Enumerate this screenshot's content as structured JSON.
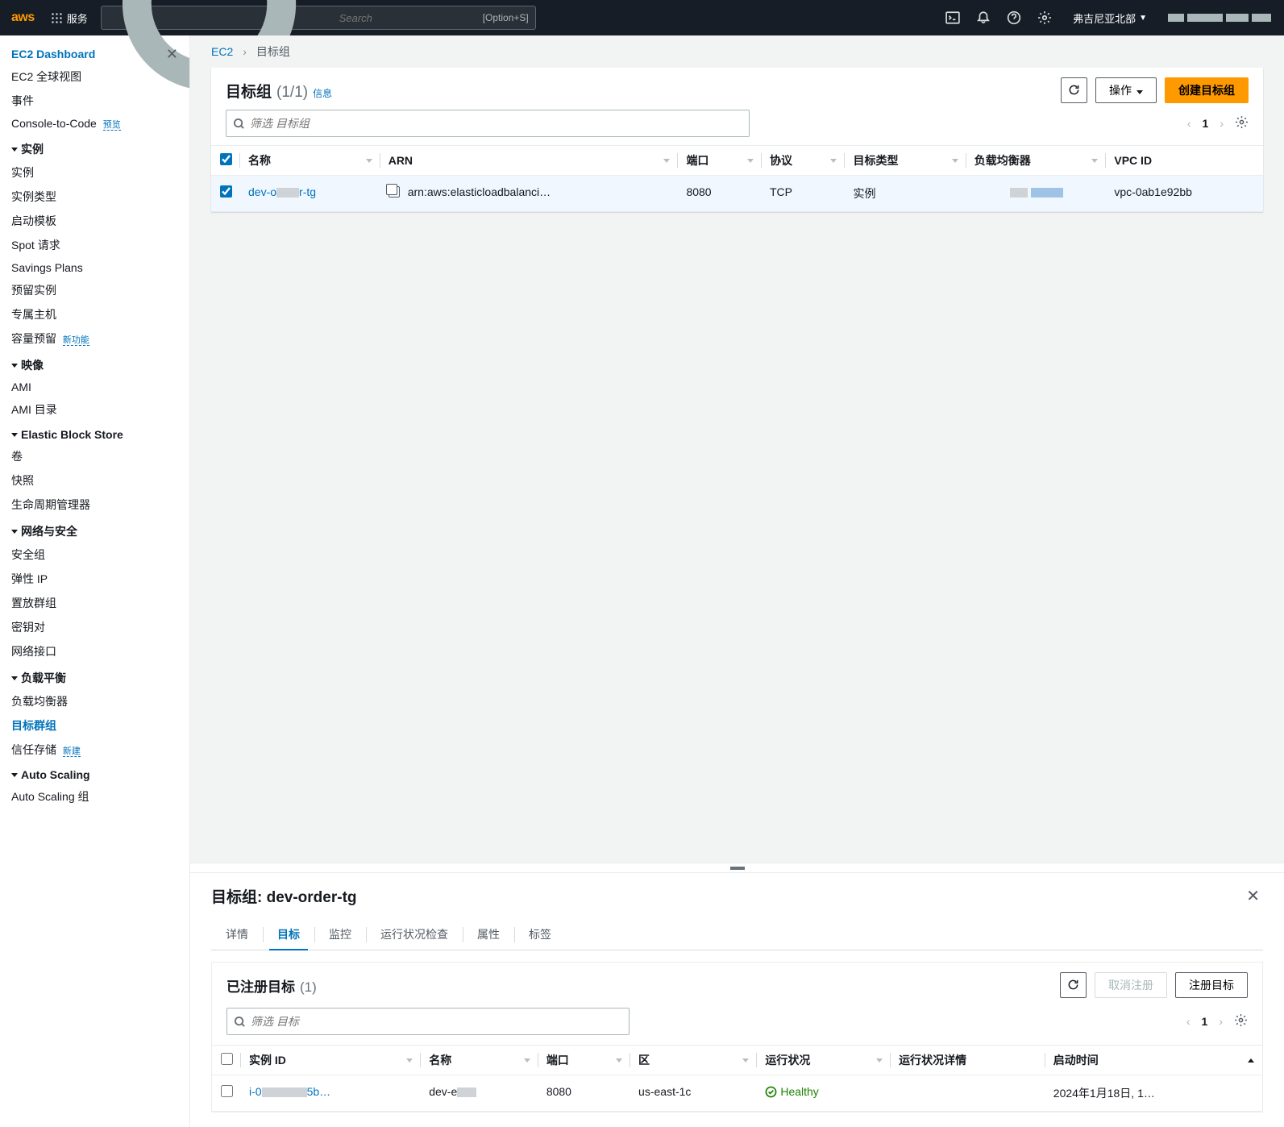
{
  "nav": {
    "services": "服务",
    "search_placeholder": "Search",
    "search_hint": "[Option+S]",
    "region": "弗吉尼亚北部"
  },
  "sidebar": {
    "dashboard": "EC2 Dashboard",
    "global_view": "EC2 全球视图",
    "events": "事件",
    "console_code": "Console-to-Code",
    "console_code_badge": "预览",
    "groups": {
      "instances": {
        "label": "实例",
        "items": [
          "实例",
          "实例类型",
          "启动模板",
          "Spot 请求",
          "Savings Plans",
          "预留实例",
          "专属主机",
          "容量预留"
        ],
        "cap_badge": "新功能"
      },
      "images": {
        "label": "映像",
        "items": [
          "AMI",
          "AMI 目录"
        ]
      },
      "ebs": {
        "label": "Elastic Block Store",
        "items": [
          "卷",
          "快照",
          "生命周期管理器"
        ]
      },
      "netsec": {
        "label": "网络与安全",
        "items": [
          "安全组",
          "弹性 IP",
          "置放群组",
          "密钥对",
          "网络接口"
        ]
      },
      "lb": {
        "label": "负载平衡",
        "items": [
          "负载均衡器",
          "目标群组",
          "信任存储"
        ],
        "trust_badge": "新建",
        "active": "目标群组"
      },
      "as": {
        "label": "Auto Scaling",
        "items": [
          "Auto Scaling 组"
        ]
      }
    }
  },
  "breadcrumb": {
    "link": "EC2",
    "current": "目标组"
  },
  "panel": {
    "title": "目标组",
    "count": "(1/1)",
    "info": "信息",
    "refresh": "刷新",
    "actions_btn": "操作",
    "create_btn": "创建目标组",
    "filter_placeholder": "筛选 目标组",
    "page": "1"
  },
  "table": {
    "headers": {
      "name": "名称",
      "arn": "ARN",
      "port": "端口",
      "protocol": "协议",
      "target_type": "目标类型",
      "lb": "负载均衡器",
      "vpc": "VPC ID"
    },
    "row": {
      "name_prefix": "dev-o",
      "name_suffix": "r-tg",
      "arn": "arn:aws:elasticloadbalanci…",
      "port": "8080",
      "protocol": "TCP",
      "target_type": "实例",
      "vpc": "vpc-0ab1e92bb"
    }
  },
  "detail": {
    "title_prefix": "目标组: ",
    "title_name": "dev-order-tg",
    "tabs": {
      "details": "详情",
      "targets": "目标",
      "monitoring": "监控",
      "health": "运行状况检查",
      "attrs": "属性",
      "tags": "标签"
    },
    "active_tab": "targets",
    "reg_title": "已注册目标",
    "reg_count": "(1)",
    "dereg_btn": "取消注册",
    "reg_btn": "注册目标",
    "filter_placeholder": "筛选 目标",
    "page": "1",
    "headers": {
      "id": "实例 ID",
      "name": "名称",
      "port": "端口",
      "zone": "区",
      "health": "运行状况",
      "health_detail": "运行状况详情",
      "launch": "启动时间"
    },
    "row": {
      "id_prefix": "i-0",
      "id_suffix": "5b…",
      "name_prefix": "dev-e",
      "port": "8080",
      "zone": "us-east-1c",
      "health": "Healthy",
      "launch": "2024年1月18日, 1…"
    }
  }
}
